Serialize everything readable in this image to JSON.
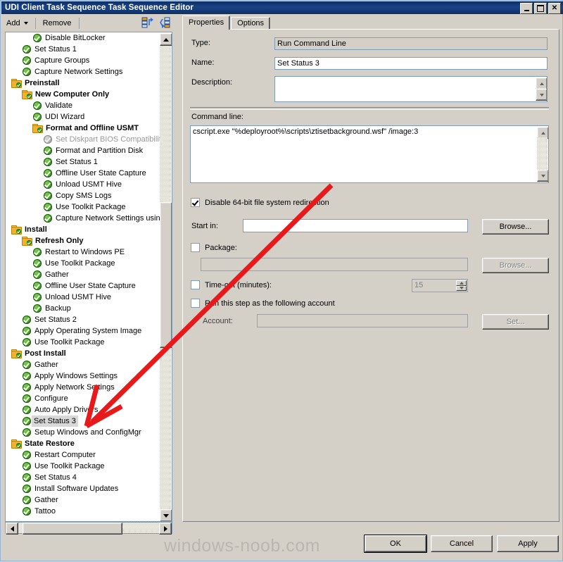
{
  "window": {
    "title": "UDI Client Task Sequence Task Sequence Editor",
    "minimize": "minimize-button",
    "maximize": "maximize-button",
    "close": "✕"
  },
  "toolbar": {
    "add_label": "Add",
    "remove_label": "Remove",
    "icon_move_up": "move-up-icon",
    "icon_move_down": "move-down-icon"
  },
  "tree": {
    "items": [
      {
        "label": "Disable BitLocker",
        "indent": 3,
        "type": "step",
        "state": "enabled",
        "selected": false
      },
      {
        "label": "Set Status 1",
        "indent": 2,
        "type": "step",
        "state": "enabled",
        "selected": false
      },
      {
        "label": "Capture Groups",
        "indent": 2,
        "type": "step",
        "state": "enabled",
        "selected": false
      },
      {
        "label": "Capture Network Settings",
        "indent": 2,
        "type": "step",
        "state": "enabled",
        "selected": false
      },
      {
        "label": "Preinstall",
        "indent": 1,
        "type": "folder",
        "state": "enabled",
        "selected": false
      },
      {
        "label": "New Computer Only",
        "indent": 2,
        "type": "folder",
        "state": "enabled",
        "selected": false
      },
      {
        "label": "Validate",
        "indent": 3,
        "type": "step",
        "state": "enabled",
        "selected": false
      },
      {
        "label": "UDI Wizard",
        "indent": 3,
        "type": "step",
        "state": "enabled",
        "selected": false
      },
      {
        "label": "Format and Offline USMT",
        "indent": 3,
        "type": "folder",
        "state": "enabled",
        "selected": false
      },
      {
        "label": "Set Diskpart BIOS Compatibilit",
        "indent": 4,
        "type": "step",
        "state": "disabled",
        "selected": false
      },
      {
        "label": "Format and Partition Disk",
        "indent": 4,
        "type": "step",
        "state": "enabled",
        "selected": false
      },
      {
        "label": "Set Status 1",
        "indent": 4,
        "type": "step",
        "state": "enabled",
        "selected": false
      },
      {
        "label": "Offline User State Capture",
        "indent": 4,
        "type": "step",
        "state": "enabled",
        "selected": false
      },
      {
        "label": "Unload USMT Hive",
        "indent": 4,
        "type": "step",
        "state": "enabled",
        "selected": false
      },
      {
        "label": "Copy SMS Logs",
        "indent": 4,
        "type": "step",
        "state": "enabled",
        "selected": false
      },
      {
        "label": "Use Toolkit Package",
        "indent": 4,
        "type": "step",
        "state": "enabled",
        "selected": false
      },
      {
        "label": "Capture Network Settings usin",
        "indent": 4,
        "type": "step",
        "state": "enabled",
        "selected": false
      },
      {
        "label": "Install",
        "indent": 1,
        "type": "folder",
        "state": "enabled",
        "selected": false
      },
      {
        "label": "Refresh Only",
        "indent": 2,
        "type": "folder",
        "state": "enabled",
        "selected": false
      },
      {
        "label": "Restart to Windows PE",
        "indent": 3,
        "type": "step",
        "state": "enabled",
        "selected": false
      },
      {
        "label": "Use Toolkit Package",
        "indent": 3,
        "type": "step",
        "state": "enabled",
        "selected": false
      },
      {
        "label": "Gather",
        "indent": 3,
        "type": "step",
        "state": "enabled",
        "selected": false
      },
      {
        "label": "Offline User State Capture",
        "indent": 3,
        "type": "step",
        "state": "enabled",
        "selected": false
      },
      {
        "label": "Unload USMT Hive",
        "indent": 3,
        "type": "step",
        "state": "enabled",
        "selected": false
      },
      {
        "label": "Backup",
        "indent": 3,
        "type": "step",
        "state": "enabled",
        "selected": false
      },
      {
        "label": "Set Status 2",
        "indent": 2,
        "type": "step",
        "state": "enabled",
        "selected": false
      },
      {
        "label": "Apply Operating System Image",
        "indent": 2,
        "type": "step",
        "state": "enabled",
        "selected": false
      },
      {
        "label": "Use Toolkit Package",
        "indent": 2,
        "type": "step",
        "state": "enabled",
        "selected": false
      },
      {
        "label": "Post Install",
        "indent": 1,
        "type": "folder",
        "state": "enabled",
        "selected": false
      },
      {
        "label": "Gather",
        "indent": 2,
        "type": "step",
        "state": "enabled",
        "selected": false
      },
      {
        "label": "Apply Windows Settings",
        "indent": 2,
        "type": "step",
        "state": "enabled",
        "selected": false
      },
      {
        "label": "Apply Network Settings",
        "indent": 2,
        "type": "step",
        "state": "enabled",
        "selected": false
      },
      {
        "label": "Configure",
        "indent": 2,
        "type": "step",
        "state": "enabled",
        "selected": false
      },
      {
        "label": "Auto Apply Drivers",
        "indent": 2,
        "type": "step",
        "state": "enabled",
        "selected": false
      },
      {
        "label": "Set Status 3",
        "indent": 2,
        "type": "step",
        "state": "enabled",
        "selected": true
      },
      {
        "label": "Setup Windows and ConfigMgr",
        "indent": 2,
        "type": "step",
        "state": "enabled",
        "selected": false
      },
      {
        "label": "State Restore",
        "indent": 1,
        "type": "folder",
        "state": "enabled",
        "selected": false
      },
      {
        "label": "Restart Computer",
        "indent": 2,
        "type": "step",
        "state": "enabled",
        "selected": false
      },
      {
        "label": "Use Toolkit Package",
        "indent": 2,
        "type": "step",
        "state": "enabled",
        "selected": false
      },
      {
        "label": "Set Status 4",
        "indent": 2,
        "type": "step",
        "state": "enabled",
        "selected": false
      },
      {
        "label": "Install Software Updates",
        "indent": 2,
        "type": "step",
        "state": "enabled",
        "selected": false
      },
      {
        "label": "Gather",
        "indent": 2,
        "type": "step",
        "state": "enabled",
        "selected": false
      },
      {
        "label": "Tattoo",
        "indent": 2,
        "type": "step",
        "state": "enabled",
        "selected": false
      }
    ]
  },
  "tabs": [
    {
      "label": "Properties",
      "active": true
    },
    {
      "label": "Options",
      "active": false
    }
  ],
  "properties": {
    "type_label": "Type:",
    "type_value": "Run Command Line",
    "name_label": "Name:",
    "name_value": "Set Status 3",
    "description_label": "Description:",
    "description_value": "",
    "commandline_label": "Command line:",
    "commandline_value": "cscript.exe \"%deployroot%\\scripts\\ztisetbackground.wsf\" /image:3",
    "disable_redirection_label": "Disable 64-bit file system redirection",
    "disable_redirection_checked": true,
    "startin_label": "Start in:",
    "startin_value": "",
    "startin_browse": "Browse...",
    "package_label": "Package:",
    "package_checked": false,
    "package_value": "",
    "package_browse": "Browse...",
    "timeout_label": "Time-out (minutes):",
    "timeout_checked": false,
    "timeout_value": "15",
    "runas_label": "Run this step as the following account",
    "runas_checked": false,
    "account_label": "Account:",
    "account_value": "",
    "account_set": "Set..."
  },
  "footer": {
    "ok": "OK",
    "cancel": "Cancel",
    "apply": "Apply",
    "watermark": "windows-noob.com"
  },
  "annotation": {
    "arrow_color": "#e8191b"
  }
}
